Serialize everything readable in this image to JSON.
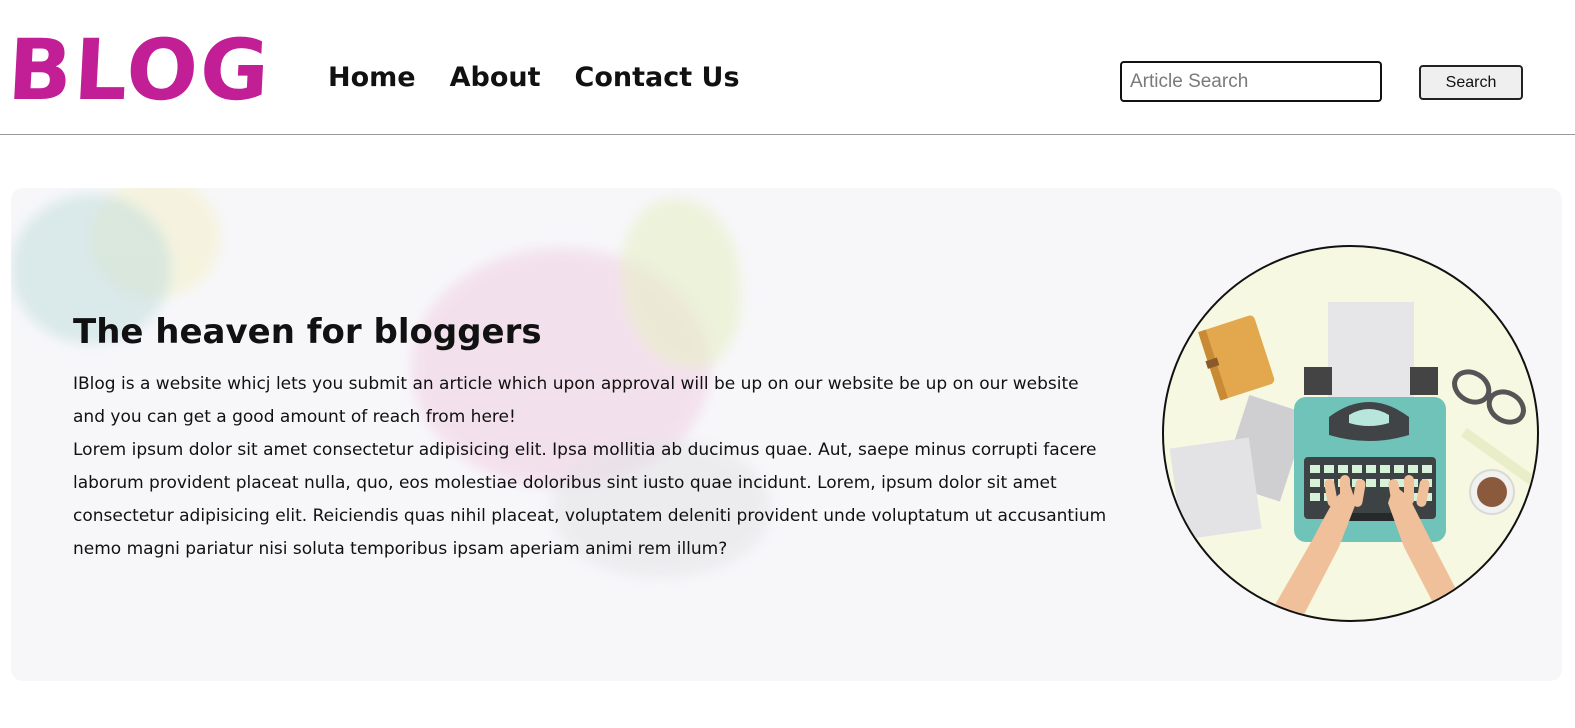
{
  "header": {
    "logo": "BLOG",
    "nav": [
      {
        "label": "Home"
      },
      {
        "label": "About"
      },
      {
        "label": "Contact Us"
      }
    ],
    "search": {
      "placeholder": "Article Search",
      "value": "",
      "button_label": "Search"
    }
  },
  "hero": {
    "title": "The heaven for bloggers",
    "paragraph1": "IBlog is a website whicj lets you submit an article which upon approval will be up on our website be up on our website and you can get a good amount of reach from here!",
    "paragraph2": "Lorem ipsum dolor sit amet consectetur adipisicing elit. Ipsa mollitia ab ducimus quae. Aut, saepe minus corrupti facere laborum provident placeat nulla, quo, eos molestiae doloribus sint iusto quae incidunt. Lorem, ipsum dolor sit amet consectetur adipisicing elit. Reiciendis quas nihil placeat, voluptatem deleniti provident unde voluptatum ut accusantium nemo magni pariatur nisi soluta temporibus ipsam aperiam animi rem illum?"
  },
  "colors": {
    "brand": "#c21e96",
    "typewriter": "#6fc3b9",
    "illustration_bg": "#f6f8e1"
  }
}
